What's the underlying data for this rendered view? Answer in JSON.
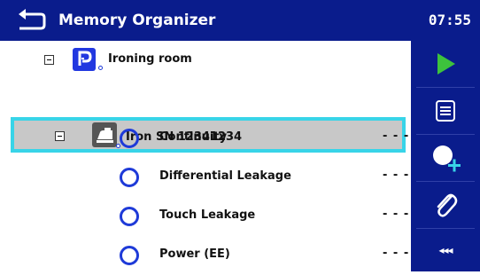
{
  "header": {
    "title": "Memory Organizer",
    "time": "07:55"
  },
  "tree": {
    "location": {
      "label": "Ironing room",
      "icon": "location-p-icon"
    },
    "appliance": {
      "label": "Iron SN 12341234",
      "icon": "iron-icon"
    },
    "tests": [
      {
        "label": "Continuity",
        "status": "- - -"
      },
      {
        "label": "Differential Leakage",
        "status": "- - -"
      },
      {
        "label": "Touch Leakage",
        "status": "- - -"
      },
      {
        "label": "Power (EE)",
        "status": "- - -"
      }
    ]
  },
  "sidebar": {
    "buttons": [
      "start-test",
      "view-results",
      "add-node",
      "attach",
      "more"
    ],
    "more_label": "◂◂◂"
  },
  "colors": {
    "header_bg": "#0a1c8c",
    "selection_border": "#38d4e8",
    "selection_bg": "#c8c8c8",
    "play_green": "#3dc23d",
    "circle_blue": "#1e3ad8"
  }
}
